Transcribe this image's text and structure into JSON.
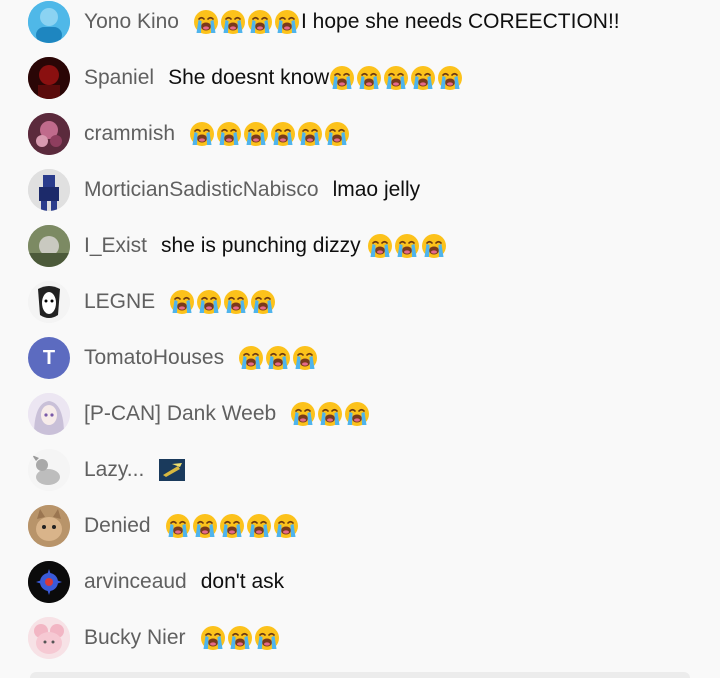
{
  "messages": [
    {
      "author": "Yono Kino",
      "pre_text": "",
      "emoji_count": 4,
      "post_text": "I hope she needs COREECTION!!",
      "emoji": "loudly-crying-face"
    },
    {
      "author": "Spaniel",
      "pre_text": "She doesnt know",
      "emoji_count": 5,
      "post_text": "",
      "emoji": "loudly-crying-face"
    },
    {
      "author": "crammish",
      "pre_text": "",
      "emoji_count": 6,
      "post_text": "",
      "emoji": "loudly-crying-face"
    },
    {
      "author": "MorticianSadisticNabisco",
      "pre_text": "lmao jelly",
      "emoji_count": 0,
      "post_text": "",
      "emoji": ""
    },
    {
      "author": "I_Exist",
      "pre_text": "she is punching dizzy",
      "emoji_count": 3,
      "post_text": "",
      "emoji": "loudly-crying-face"
    },
    {
      "author": "LEGNE",
      "pre_text": "",
      "emoji_count": 4,
      "post_text": "",
      "emoji": "loudly-crying-face"
    },
    {
      "author": "TomatoHouses",
      "pre_text": "",
      "emoji_count": 3,
      "post_text": "",
      "emoji": "loudly-crying-face",
      "avatar_letter": "T"
    },
    {
      "author": "[P-CAN] Dank Weeb",
      "pre_text": "",
      "emoji_count": 3,
      "post_text": "",
      "emoji": "loudly-crying-face"
    },
    {
      "author": "Lazy...",
      "pre_text": "",
      "emoji_count": 0,
      "post_text": "",
      "emoji": "custom-emote-icon"
    },
    {
      "author": "Denied",
      "pre_text": "",
      "emoji_count": 5,
      "post_text": "",
      "emoji": "loudly-crying-face"
    },
    {
      "author": "arvinceaud",
      "pre_text": "don't ask",
      "emoji_count": 0,
      "post_text": "",
      "emoji": ""
    },
    {
      "author": "Bucky Nier",
      "pre_text": "",
      "emoji_count": 3,
      "post_text": "",
      "emoji": "loudly-crying-face"
    }
  ],
  "colors": {
    "background": "#f9f9f9",
    "author_text": "#606060",
    "message_text": "#0f0f0f",
    "letter_avatar": "#5c6bc0"
  }
}
